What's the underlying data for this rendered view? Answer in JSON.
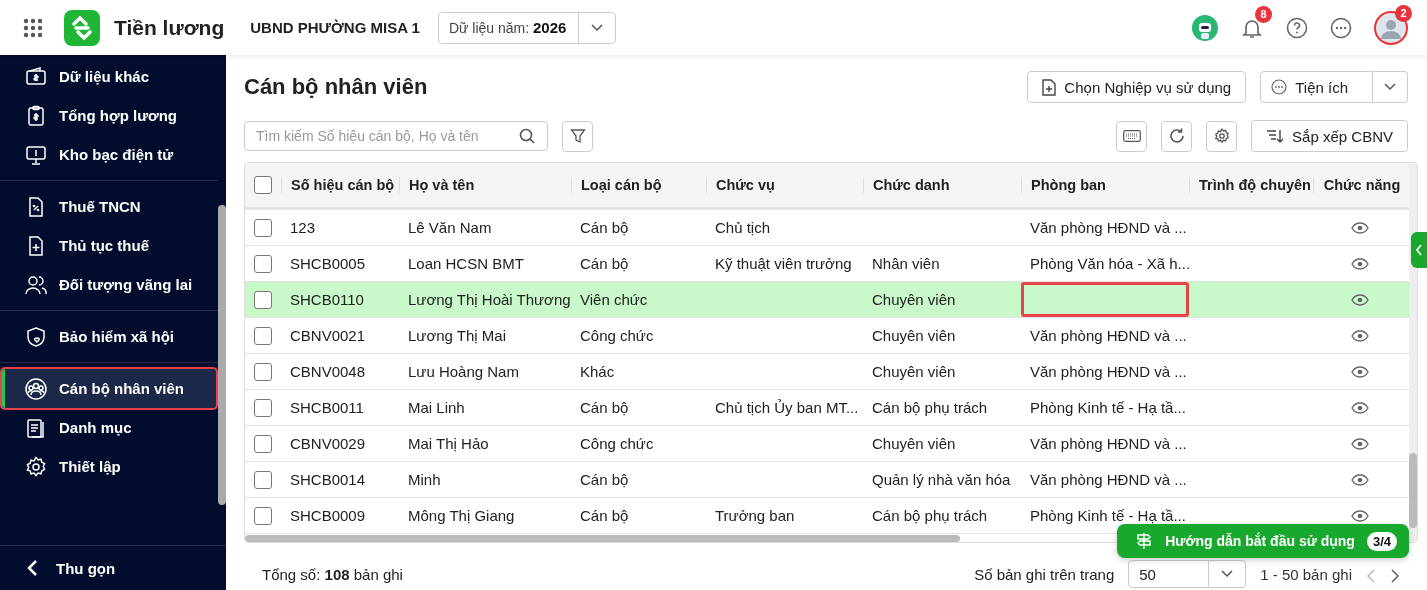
{
  "app": {
    "name": "Tiền lương",
    "organization": "UBND PHƯỜNG MISA 1",
    "year_label": "Dữ liệu năm:",
    "year": "2026"
  },
  "topbar": {
    "notification_count": "8",
    "avatar_badge": "2"
  },
  "sidebar": {
    "groups": [
      [
        {
          "label": "Dữ liệu khác",
          "selected": false,
          "outlined": false
        },
        {
          "label": "Tổng hợp lương",
          "selected": false,
          "outlined": false
        },
        {
          "label": "Kho bạc điện tử",
          "selected": false,
          "outlined": false
        }
      ],
      [
        {
          "label": "Thuế TNCN",
          "selected": false,
          "outlined": false
        },
        {
          "label": "Thủ tục thuế",
          "selected": false,
          "outlined": false
        },
        {
          "label": "Đối tượng vãng lai",
          "selected": false,
          "outlined": false
        }
      ],
      [
        {
          "label": "Bảo hiểm xã hội",
          "selected": false,
          "outlined": false
        }
      ],
      [
        {
          "label": "Cán bộ nhân viên",
          "selected": true,
          "outlined": true
        },
        {
          "label": "Danh mục",
          "selected": false,
          "outlined": false
        },
        {
          "label": "Thiết lập",
          "selected": false,
          "outlined": false
        }
      ]
    ],
    "collapse_label": "Thu gọn"
  },
  "page": {
    "title": "Cán bộ nhân viên",
    "choose_button": "Chọn Nghiệp vụ sử dụng",
    "utility_button": "Tiện ích",
    "search_placeholder": "Tìm kiếm Số hiệu cán bộ, Họ và tên",
    "sort_button": "Sắp xếp CBNV"
  },
  "table": {
    "all_checked": false,
    "columns": [
      "Số hiệu cán bộ",
      "Họ và tên",
      "Loại cán bộ",
      "Chức vụ",
      "Chức danh",
      "Phòng ban",
      "Trình độ chuyên",
      "Chức năng"
    ],
    "rows": [
      {
        "cells": [
          "123",
          "Lê Văn Nam",
          "Cán bộ",
          "Chủ tịch",
          "",
          "Văn phòng HĐND và ...",
          ""
        ],
        "checked": false,
        "selected": false,
        "department_outlined": false
      },
      {
        "cells": [
          "SHCB0005",
          "Loan HCSN BMT",
          "Cán bộ",
          "Kỹ thuật viên trưởng",
          "Nhân viên",
          "Phòng Văn hóa - Xã h...",
          ""
        ],
        "checked": false,
        "selected": false,
        "department_outlined": false
      },
      {
        "cells": [
          "SHCB0110",
          "Lương Thị Hoài Thương",
          "Viên chức",
          "",
          "Chuyên viên",
          "",
          ""
        ],
        "checked": false,
        "selected": true,
        "department_outlined": true
      },
      {
        "cells": [
          "CBNV0021",
          "Lương Thị Mai",
          "Công chức",
          "",
          "Chuyên viên",
          "Văn phòng HĐND và ...",
          ""
        ],
        "checked": false,
        "selected": false,
        "department_outlined": false
      },
      {
        "cells": [
          "CBNV0048",
          "Lưu Hoàng Nam",
          "Khác",
          "",
          "Chuyên viên",
          "Văn phòng HĐND và ...",
          ""
        ],
        "checked": false,
        "selected": false,
        "department_outlined": false
      },
      {
        "cells": [
          "SHCB0011",
          "Mai Linh",
          "Cán bộ",
          "Chủ tịch Ủy ban MT...",
          "Cán bộ phụ trách",
          "Phòng Kinh tế - Hạ tầ...",
          ""
        ],
        "checked": false,
        "selected": false,
        "department_outlined": false
      },
      {
        "cells": [
          "CBNV0029",
          "Mai Thị Hảo",
          "Công chức",
          "",
          "Chuyên viên",
          "Văn phòng HĐND và ...",
          ""
        ],
        "checked": false,
        "selected": false,
        "department_outlined": false
      },
      {
        "cells": [
          "SHCB0014",
          "Minh",
          "Cán bộ",
          "",
          "Quản lý nhà văn hóa",
          "Văn phòng HĐND và ...",
          ""
        ],
        "checked": false,
        "selected": false,
        "department_outlined": false
      },
      {
        "cells": [
          "SHCB0009",
          "Mông Thị Giang",
          "Cán bộ",
          "Trưởng ban",
          "Cán bộ phụ trách",
          "Phòng Kinh tế - Hạ tầ...",
          ""
        ],
        "checked": false,
        "selected": false,
        "department_outlined": false
      }
    ]
  },
  "footer": {
    "total": "Tổng số: **108** bản ghi",
    "page_size_label": "Số bản ghi trên trang",
    "page_size": "50",
    "range": "1 - 50 bản ghi"
  },
  "guide_button": {
    "label": "Hướng dẫn bắt đầu sử dụng",
    "step": "3/4"
  }
}
